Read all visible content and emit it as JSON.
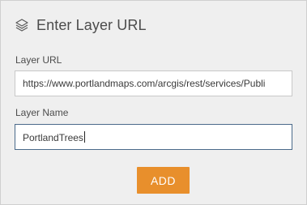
{
  "header": {
    "icon": "layers-icon",
    "title": "Enter Layer URL"
  },
  "fields": {
    "url": {
      "label": "Layer URL",
      "value": "https://www.portlandmaps.com/arcgis/rest/services/Publi"
    },
    "name": {
      "label": "Layer Name",
      "value": "PortlandTrees"
    }
  },
  "actions": {
    "add_label": "ADD"
  },
  "colors": {
    "panel_background": "#efefef",
    "accent": "#e88f2c",
    "focused_border": "#4b6a8a"
  }
}
